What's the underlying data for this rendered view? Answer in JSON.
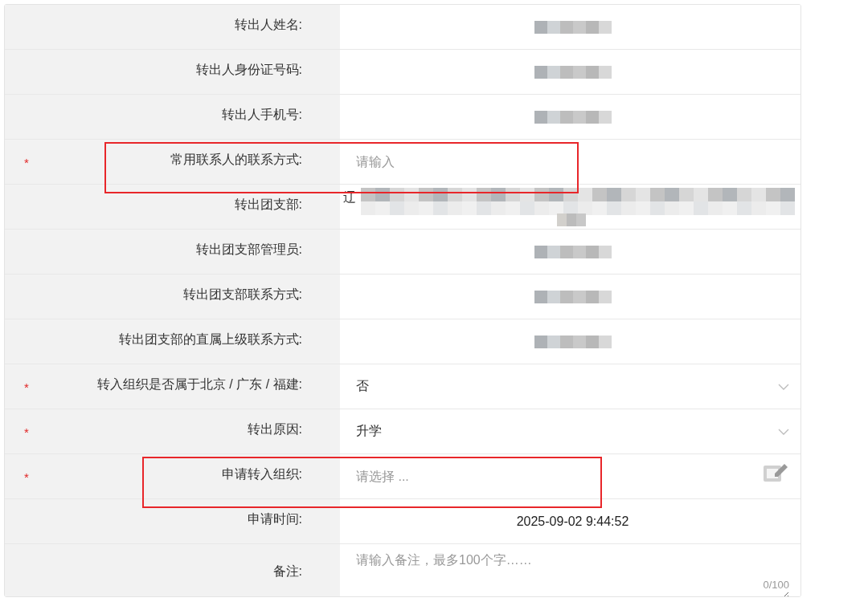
{
  "rows": [
    {
      "label": "转出人姓名:",
      "highlighted": false,
      "value": {
        "kind": "redacted"
      }
    },
    {
      "label": "转出人身份证号码:",
      "highlighted": false,
      "value": {
        "kind": "redacted"
      }
    },
    {
      "label": "转出人手机号:",
      "highlighted": false,
      "value": {
        "kind": "redacted"
      }
    },
    {
      "label": "常用联系人的联系方式:",
      "marker": "*",
      "highlighted": true,
      "value": {
        "kind": "input",
        "placeholder": "请输入"
      }
    },
    {
      "label": "转出团支部:",
      "highlighted": false,
      "value": {
        "kind": "partial",
        "text": "辽"
      }
    },
    {
      "label": "转出团支部管理员:",
      "highlighted": false,
      "value": {
        "kind": "redacted"
      }
    },
    {
      "label": "转出团支部联系方式:",
      "highlighted": false,
      "value": {
        "kind": "redacted"
      }
    },
    {
      "label": "转出团支部的直属上级联系方式:",
      "highlighted": false,
      "value": {
        "kind": "redacted"
      }
    },
    {
      "label": "转入组织是否属于北京 / 广东 / 福建:",
      "marker": "*",
      "highlighted": false,
      "value": {
        "kind": "select",
        "text": "否"
      }
    },
    {
      "label": "转出原因:",
      "marker": "*",
      "highlighted": false,
      "value": {
        "kind": "select",
        "text": "升学"
      }
    },
    {
      "label": "申请转入组织:",
      "marker": "*",
      "highlighted": true,
      "value": {
        "kind": "picker",
        "placeholder": "请选择 ..."
      }
    },
    {
      "label": "申请时间:",
      "highlighted": false,
      "value": {
        "kind": "static",
        "text": "2025-09-02 9:44:52"
      }
    },
    {
      "label": "备注:",
      "highlighted": false,
      "value": {
        "kind": "textarea",
        "placeholder": "请输入备注，最多100个字……",
        "counter": "0/100"
      }
    }
  ]
}
